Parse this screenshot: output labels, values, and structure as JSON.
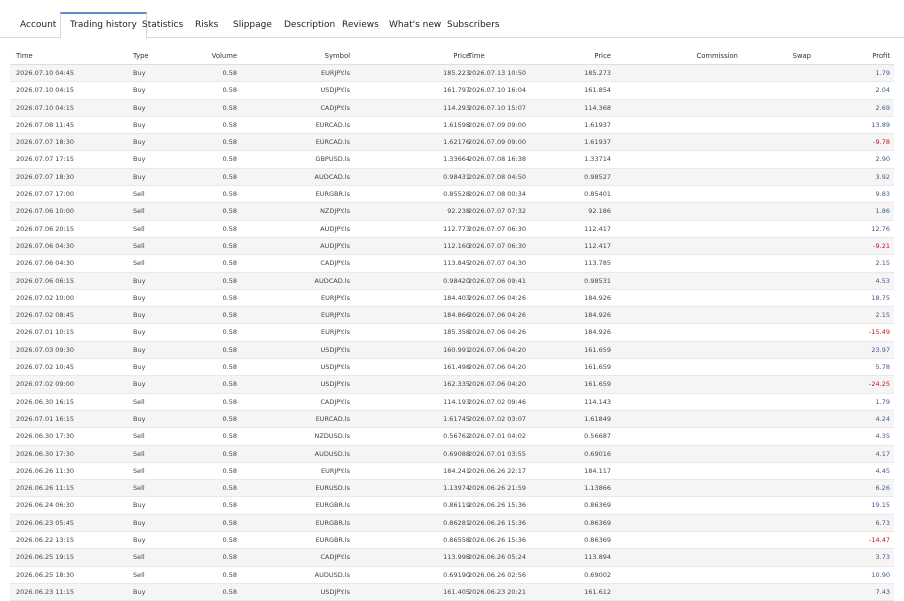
{
  "tabs": [
    {
      "label": "Account"
    },
    {
      "label": "Trading history",
      "active": true
    },
    {
      "label": "Statistics"
    },
    {
      "label": "Risks"
    },
    {
      "label": "Slippage"
    },
    {
      "label": "Description"
    },
    {
      "label": "Reviews"
    },
    {
      "label": "What's new"
    },
    {
      "label": "Subscribers"
    }
  ],
  "columns": {
    "open_time": "Time",
    "type": "Type",
    "volume": "Volume",
    "symbol": "Symbol",
    "open_price": "Price",
    "close_time": "Time",
    "close_price": "Price",
    "commission": "Commission",
    "swap": "Swap",
    "profit": "Profit"
  },
  "colors": {
    "positive": "#3a5d93",
    "negative": "#c4151c",
    "active_tab": "#5b8fc7"
  },
  "rows": [
    {
      "open_time": "2026.07.10 04:45",
      "type": "Buy",
      "volume": "0.58",
      "symbol": "EURJPY.ls",
      "open_price": "185.223",
      "close_time": "2026.07.13 10:50",
      "close_price": "185.273",
      "commission": "",
      "swap": "",
      "profit": "1.79"
    },
    {
      "open_time": "2026.07.10 04:15",
      "type": "Buy",
      "volume": "0.58",
      "symbol": "USDJPY.ls",
      "open_price": "161.797",
      "close_time": "2026.07.10 16:04",
      "close_price": "161.854",
      "commission": "",
      "swap": "",
      "profit": "2.04"
    },
    {
      "open_time": "2026.07.10 04:15",
      "type": "Buy",
      "volume": "0.58",
      "symbol": "CADJPY.ls",
      "open_price": "114.293",
      "close_time": "2026.07.10 15:07",
      "close_price": "114.368",
      "commission": "",
      "swap": "",
      "profit": "2.69"
    },
    {
      "open_time": "2026.07.08 11:45",
      "type": "Buy",
      "volume": "0.58",
      "symbol": "EURCAD.ls",
      "open_price": "1.61598",
      "close_time": "2026.07.09 09:00",
      "close_price": "1.61937",
      "commission": "",
      "swap": "",
      "profit": "13.89"
    },
    {
      "open_time": "2026.07.07 18:30",
      "type": "Buy",
      "volume": "0.58",
      "symbol": "EURCAD.ls",
      "open_price": "1.62176",
      "close_time": "2026.07.09 09:00",
      "close_price": "1.61937",
      "commission": "",
      "swap": "",
      "profit": "-9.78"
    },
    {
      "open_time": "2026.07.07 17:15",
      "type": "Buy",
      "volume": "0.58",
      "symbol": "GBPUSD.ls",
      "open_price": "1.33664",
      "close_time": "2026.07.08 16:38",
      "close_price": "1.33714",
      "commission": "",
      "swap": "",
      "profit": "2.90"
    },
    {
      "open_time": "2026.07.07 18:30",
      "type": "Buy",
      "volume": "0.58",
      "symbol": "AUDCAD.ls",
      "open_price": "0.98431",
      "close_time": "2026.07.08 04:50",
      "close_price": "0.98527",
      "commission": "",
      "swap": "",
      "profit": "3.92"
    },
    {
      "open_time": "2026.07.07 17:00",
      "type": "Sell",
      "volume": "0.58",
      "symbol": "EURGBR.ls",
      "open_price": "0.85528",
      "close_time": "2026.07.08 00:34",
      "close_price": "0.85401",
      "commission": "",
      "swap": "",
      "profit": "9.83"
    },
    {
      "open_time": "2026.07.06 10:00",
      "type": "Sell",
      "volume": "0.58",
      "symbol": "NZDJPY.ls",
      "open_price": "92.238",
      "close_time": "2026.07.07 07:32",
      "close_price": "92.186",
      "commission": "",
      "swap": "",
      "profit": "1.86"
    },
    {
      "open_time": "2026.07.06 20:15",
      "type": "Sell",
      "volume": "0.58",
      "symbol": "AUDJPY.ls",
      "open_price": "112.773",
      "close_time": "2026.07.07 06:30",
      "close_price": "112.417",
      "commission": "",
      "swap": "",
      "profit": "12.76"
    },
    {
      "open_time": "2026.07.06 04:30",
      "type": "Sell",
      "volume": "0.58",
      "symbol": "AUDJPY.ls",
      "open_price": "112.160",
      "close_time": "2026.07.07 06:30",
      "close_price": "112.417",
      "commission": "",
      "swap": "",
      "profit": "-9.21"
    },
    {
      "open_time": "2026.07.06 04:30",
      "type": "Sell",
      "volume": "0.58",
      "symbol": "CADJPY.ls",
      "open_price": "113.845",
      "close_time": "2026.07.07 04:30",
      "close_price": "113.785",
      "commission": "",
      "swap": "",
      "profit": "2.15"
    },
    {
      "open_time": "2026.07.06 06:15",
      "type": "Buy",
      "volume": "0.58",
      "symbol": "AUDCAD.ls",
      "open_price": "0.98420",
      "close_time": "2026.07.06 09:41",
      "close_price": "0.98531",
      "commission": "",
      "swap": "",
      "profit": "4.53"
    },
    {
      "open_time": "2026.07.02 10:00",
      "type": "Buy",
      "volume": "0.58",
      "symbol": "EURJPY.ls",
      "open_price": "184.403",
      "close_time": "2026.07.06 04:26",
      "close_price": "184.926",
      "commission": "",
      "swap": "",
      "profit": "18.75"
    },
    {
      "open_time": "2026.07.02 08:45",
      "type": "Buy",
      "volume": "0.58",
      "symbol": "EURJPY.ls",
      "open_price": "184.866",
      "close_time": "2026.07.06 04:26",
      "close_price": "184.926",
      "commission": "",
      "swap": "",
      "profit": "2.15"
    },
    {
      "open_time": "2026.07.01 10:15",
      "type": "Buy",
      "volume": "0.58",
      "symbol": "EURJPY.ls",
      "open_price": "185.358",
      "close_time": "2026.07.06 04:26",
      "close_price": "184.926",
      "commission": "",
      "swap": "",
      "profit": "-15.49"
    },
    {
      "open_time": "2026.07.03 09:30",
      "type": "Buy",
      "volume": "0.58",
      "symbol": "USDJPY.ls",
      "open_price": "160.991",
      "close_time": "2026.07.06 04:20",
      "close_price": "161.659",
      "commission": "",
      "swap": "",
      "profit": "23.97"
    },
    {
      "open_time": "2026.07.02 10:45",
      "type": "Buy",
      "volume": "0.58",
      "symbol": "USDJPY.ls",
      "open_price": "161.498",
      "close_time": "2026.07.06 04:20",
      "close_price": "161.659",
      "commission": "",
      "swap": "",
      "profit": "5.78"
    },
    {
      "open_time": "2026.07.02 09:00",
      "type": "Buy",
      "volume": "0.58",
      "symbol": "USDJPY.ls",
      "open_price": "162.335",
      "close_time": "2026.07.06 04:20",
      "close_price": "161.659",
      "commission": "",
      "swap": "",
      "profit": "-24.25"
    },
    {
      "open_time": "2026.06.30 16:15",
      "type": "Sell",
      "volume": "0.58",
      "symbol": "CADJPY.ls",
      "open_price": "114.193",
      "close_time": "2026.07.02 09:46",
      "close_price": "114.143",
      "commission": "",
      "swap": "",
      "profit": "1.79"
    },
    {
      "open_time": "2026.07.01 16:15",
      "type": "Buy",
      "volume": "0.58",
      "symbol": "EURCAD.ls",
      "open_price": "1.61745",
      "close_time": "2026.07.02 03:07",
      "close_price": "1.61849",
      "commission": "",
      "swap": "",
      "profit": "4.24"
    },
    {
      "open_time": "2026.06.30 17:30",
      "type": "Sell",
      "volume": "0.58",
      "symbol": "NZDUSD.ls",
      "open_price": "0.56762",
      "close_time": "2026.07.01 04:02",
      "close_price": "0.56687",
      "commission": "",
      "swap": "",
      "profit": "4.35"
    },
    {
      "open_time": "2026.06.30 17:30",
      "type": "Sell",
      "volume": "0.58",
      "symbol": "AUDUSD.ls",
      "open_price": "0.69088",
      "close_time": "2026.07.01 03:55",
      "close_price": "0.69016",
      "commission": "",
      "swap": "",
      "profit": "4.17"
    },
    {
      "open_time": "2026.06.26 11:30",
      "type": "Sell",
      "volume": "0.58",
      "symbol": "EURJPY.ls",
      "open_price": "184.241",
      "close_time": "2026.06.26 22:17",
      "close_price": "184.117",
      "commission": "",
      "swap": "",
      "profit": "4.45"
    },
    {
      "open_time": "2026.06.26 11:15",
      "type": "Sell",
      "volume": "0.58",
      "symbol": "EURUSD.ls",
      "open_price": "1.13974",
      "close_time": "2026.06.26 21:59",
      "close_price": "1.13866",
      "commission": "",
      "swap": "",
      "profit": "6.26"
    },
    {
      "open_time": "2026.06.24 06:30",
      "type": "Buy",
      "volume": "0.58",
      "symbol": "EURGBR.ls",
      "open_price": "0.86119",
      "close_time": "2026.06.26 15:36",
      "close_price": "0.86369",
      "commission": "",
      "swap": "",
      "profit": "19.15"
    },
    {
      "open_time": "2026.06.23 05:45",
      "type": "Buy",
      "volume": "0.58",
      "symbol": "EURGBR.ls",
      "open_price": "0.86281",
      "close_time": "2026.06.26 15:36",
      "close_price": "0.86369",
      "commission": "",
      "swap": "",
      "profit": "6.73"
    },
    {
      "open_time": "2026.06.22 13:15",
      "type": "Buy",
      "volume": "0.58",
      "symbol": "EURGBR.ls",
      "open_price": "0.86558",
      "close_time": "2026.06.26 15:36",
      "close_price": "0.86369",
      "commission": "",
      "swap": "",
      "profit": "-14.47"
    },
    {
      "open_time": "2026.06.25 19:15",
      "type": "Sell",
      "volume": "0.58",
      "symbol": "CADJPY.ls",
      "open_price": "113.998",
      "close_time": "2026.06.26 05:24",
      "close_price": "113.894",
      "commission": "",
      "swap": "",
      "profit": "3.73"
    },
    {
      "open_time": "2026.06.25 18:30",
      "type": "Sell",
      "volume": "0.58",
      "symbol": "AUDUSD.ls",
      "open_price": "0.69190",
      "close_time": "2026.06.26 02:56",
      "close_price": "0.69002",
      "commission": "",
      "swap": "",
      "profit": "10.90"
    },
    {
      "open_time": "2026.06.23 11:15",
      "type": "Buy",
      "volume": "0.58",
      "symbol": "USDJPY.ls",
      "open_price": "161.405",
      "close_time": "2026.06.23 20:21",
      "close_price": "161.612",
      "commission": "",
      "swap": "",
      "profit": "7.43"
    }
  ]
}
